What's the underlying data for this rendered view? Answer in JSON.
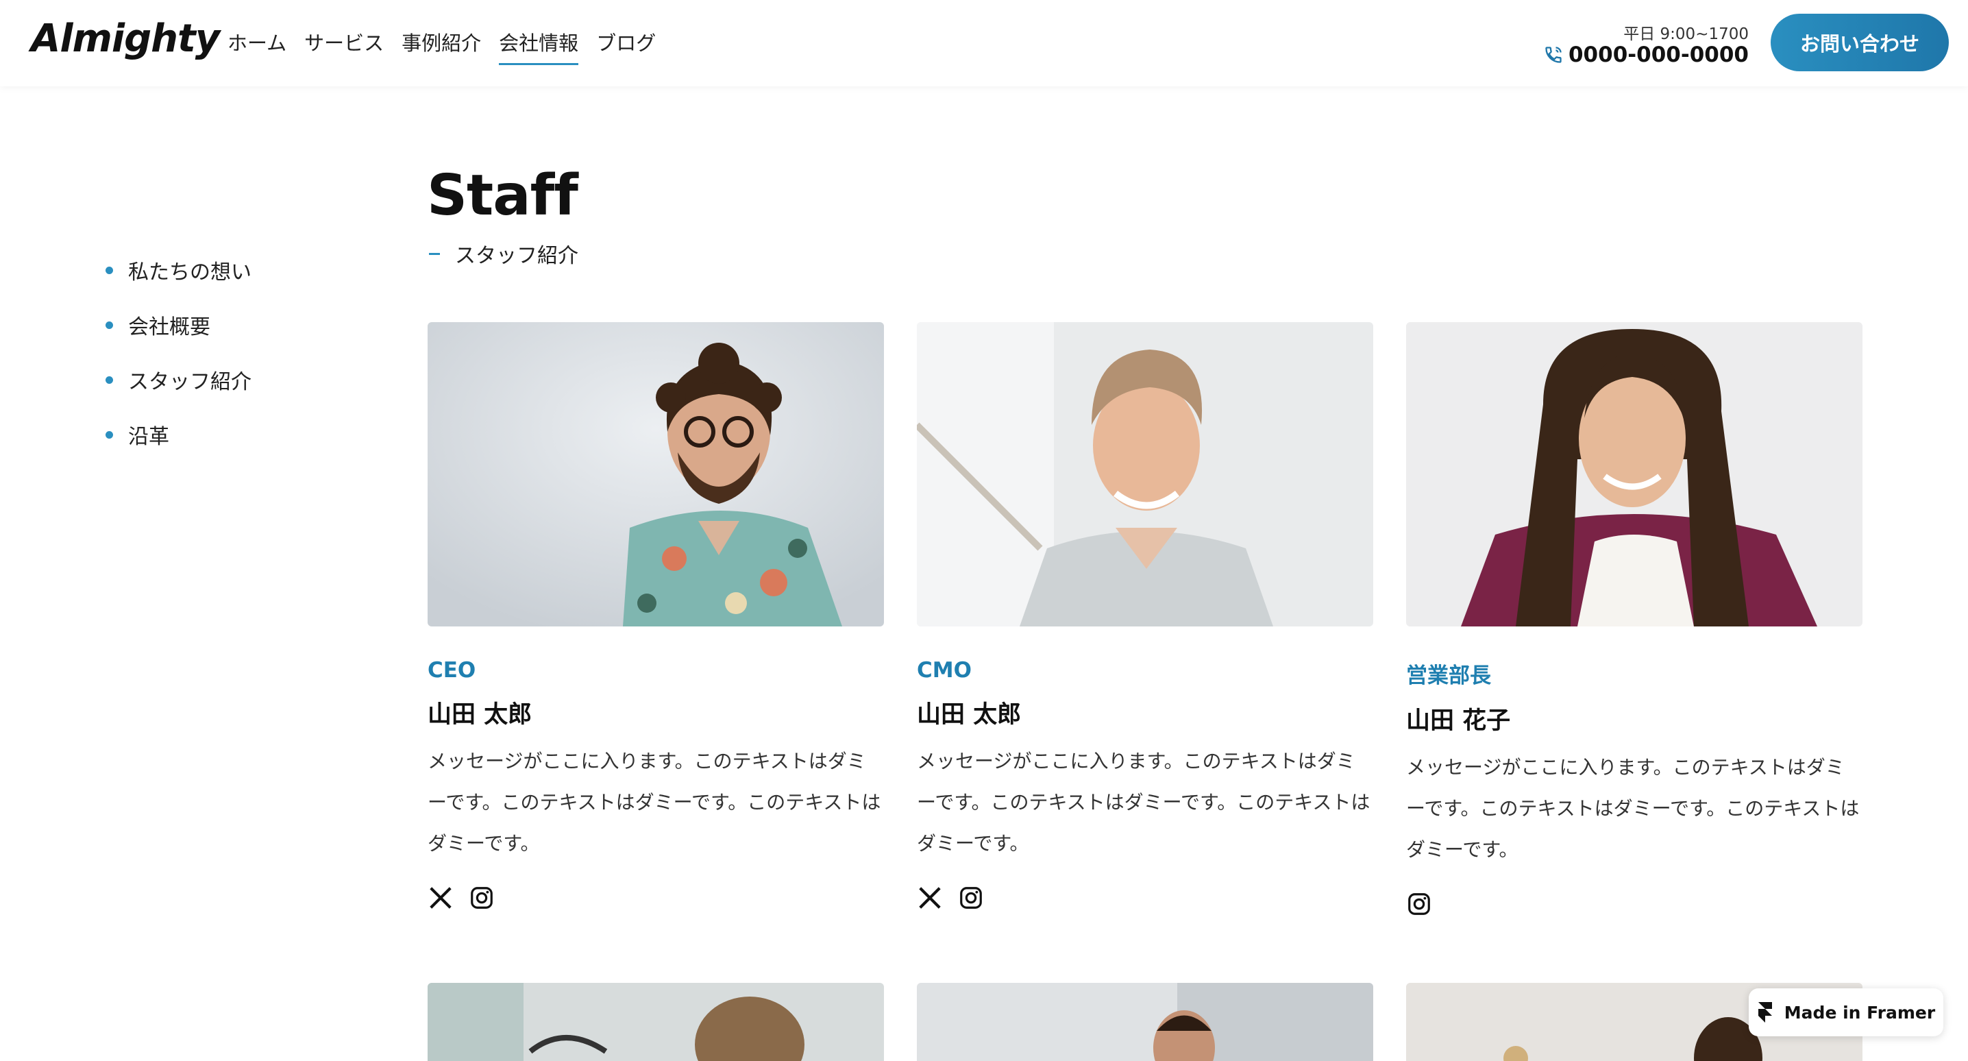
{
  "header": {
    "logo": "Almighty",
    "nav": [
      "ホーム",
      "サービス",
      "事例紹介",
      "会社情報",
      "ブログ"
    ],
    "active_nav": "会社情報",
    "hours": "平日 9:00~1700",
    "phone": "0000-000-0000",
    "cta": "お問い合わせ"
  },
  "sidebar": {
    "items": [
      "私たちの想い",
      "会社概要",
      "スタッフ紹介",
      "沿革"
    ]
  },
  "main": {
    "title": "Staff",
    "subtitle": "スタッフ紹介",
    "staff": [
      {
        "role": "CEO",
        "name": "山田 太郎",
        "message": "メッセージがここに入ります。このテキストはダミーです。このテキストはダミーです。このテキストはダミーです。",
        "socials": [
          "x-icon",
          "instagram-icon"
        ]
      },
      {
        "role": "CMO",
        "name": "山田 太郎",
        "message": "メッセージがここに入ります。このテキストはダミーです。このテキストはダミーです。このテキストはダミーです。",
        "socials": [
          "x-icon",
          "instagram-icon"
        ]
      },
      {
        "role": "営業部長",
        "name": "山田 花子",
        "message": "メッセージがここに入ります。このテキストはダミーです。このテキストはダミーです。このテキストはダミーです。",
        "socials": [
          "instagram-icon"
        ]
      }
    ]
  },
  "badge": {
    "label": "Made in Framer"
  },
  "colors": {
    "accent": "#2a8fc0",
    "role_text": "#1f7fb0"
  }
}
